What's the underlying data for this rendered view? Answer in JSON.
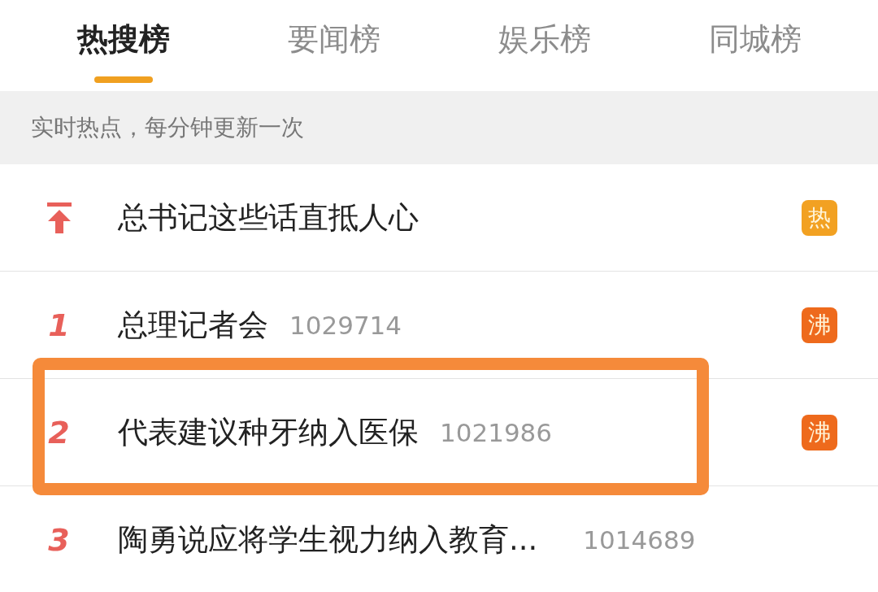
{
  "tabs": [
    {
      "label": "热搜榜",
      "selected": true
    },
    {
      "label": "要闻榜",
      "selected": false
    },
    {
      "label": "娱乐榜",
      "selected": false
    },
    {
      "label": "同城榜",
      "selected": false
    }
  ],
  "notice": "实时热点，每分钟更新一次",
  "rows": [
    {
      "kind": "pinned",
      "title": "总书记这些话直抵人心",
      "badge": {
        "text": "热",
        "color": "#f2a122"
      },
      "highlighted": false
    },
    {
      "kind": "ranked",
      "rank": "1",
      "title": "总理记者会",
      "count": "1029714",
      "badge": {
        "text": "沸",
        "color": "#ee6a1c"
      },
      "highlighted": false
    },
    {
      "kind": "ranked",
      "rank": "2",
      "title": "代表建议种牙纳入医保",
      "count": "1021986",
      "badge": {
        "text": "沸",
        "color": "#ee6a1c"
      },
      "highlighted": true
    },
    {
      "kind": "ranked",
      "rank": "3",
      "title": "陶勇说应将学生视力纳入教育...",
      "count": "1014689",
      "highlighted": false
    }
  ]
}
